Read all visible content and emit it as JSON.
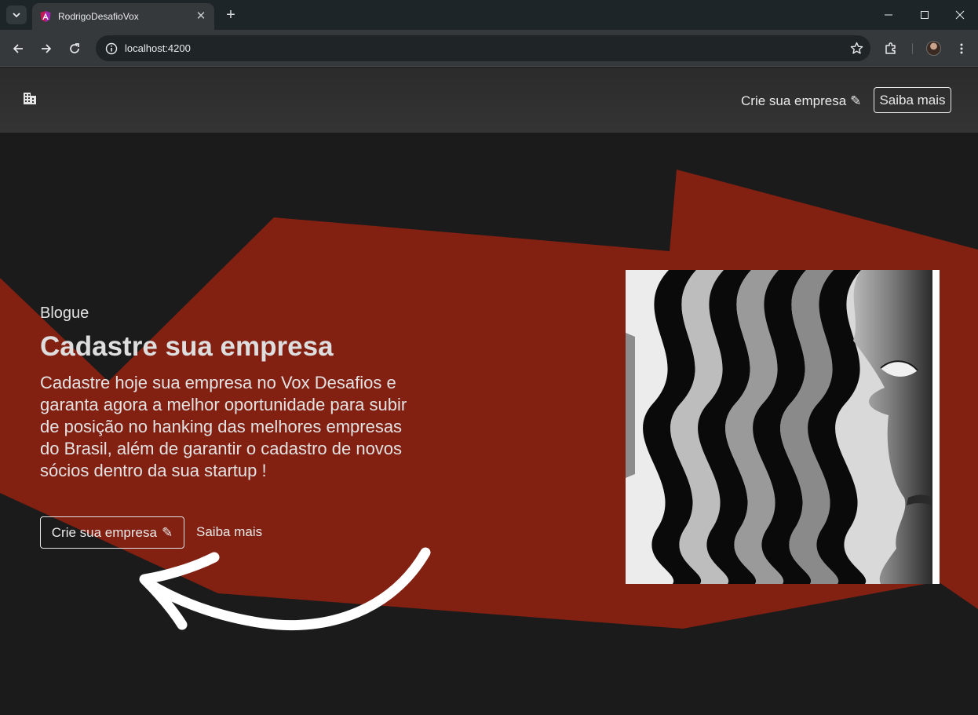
{
  "browser": {
    "tab_title": "RodrigoDesafioVox",
    "url": "localhost:4200",
    "accent": "#e2007a",
    "icons": {
      "tab_search": "chevron-down-icon",
      "tab_close": "close-icon",
      "new_tab": "plus-icon",
      "minimize": "minimize-icon",
      "maximize": "maximize-icon",
      "window_close": "close-icon",
      "back": "arrow-left-icon",
      "forward": "arrow-right-icon",
      "reload": "reload-icon",
      "site_info": "info-icon",
      "bookmark": "star-icon",
      "extensions": "puzzle-icon",
      "profile": "avatar",
      "menu": "kebab-menu-icon"
    },
    "tab_close_glyph": "✕",
    "new_tab_glyph": "+"
  },
  "navbar": {
    "brand_icon": "building-icon",
    "create_label": "Crie sua empresa",
    "create_icon": "pencil-icon",
    "more_label": "Saiba mais"
  },
  "hero": {
    "eyebrow": "Blogue",
    "title": "Cadastre sua empresa",
    "text": "Cadastre hoje sua empresa no Vox Desafios e garanta agora a melhor oportunidade para subir de posição no hanking das melhores empresas do Brasil, além de garantir o cadastro de novos sócios dentro da sua startup !",
    "create_label": "Crie sua empresa",
    "create_icon": "pencil-icon",
    "more_label": "Saiba mais",
    "arrow_icon": "curved-arrow-icon",
    "image": "black-white-wavy-face-artwork"
  },
  "colors": {
    "background": "#1b1b1b",
    "navbar": "#333333",
    "accent_red": "#822012",
    "text": "#e2e2e2"
  },
  "pencil_glyph": "✎"
}
